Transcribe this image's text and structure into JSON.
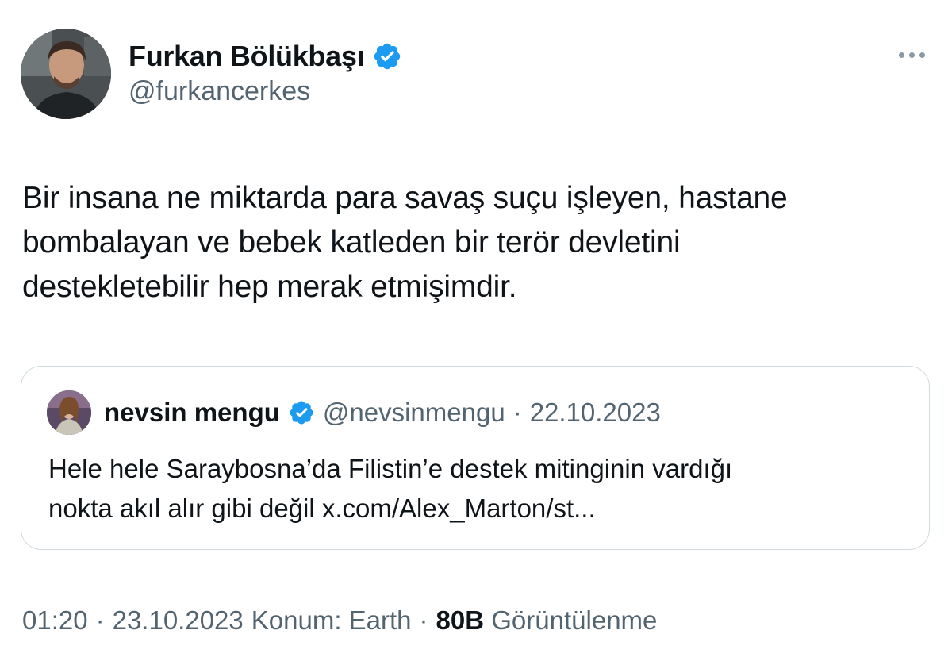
{
  "author": {
    "display_name": "Furkan Bölükbaşı",
    "handle": "@furkancerkes",
    "verified_icon": "verified-badge-icon",
    "verified_color": "#1d9bf0"
  },
  "tweet": {
    "text_lines": [
      "Bir insana ne miktarda para savaş suçu işleyen, hastane",
      "bombalayan ve bebek katleden bir terör devletini",
      "destekletebilir hep merak etmişimdir."
    ]
  },
  "quoted_tweet": {
    "display_name": "nevsin mengu",
    "handle": "@nevsinmengu",
    "separator": "·",
    "date": "22.10.2023",
    "text_lines": [
      "Hele hele Saraybosna’da Filistin’e destek mitinginin vardığı",
      "nokta akıl alır gibi değil x.com/Alex_Marton/st..."
    ]
  },
  "meta": {
    "time": "01:20",
    "sep1": "·",
    "date": "23.10.2023",
    "location": "Konum: Earth",
    "sep2": "·",
    "views_count": "80B",
    "views_label": "Görüntülenme"
  },
  "colors": {
    "text": "#0f1419",
    "secondary": "#536471",
    "border": "#cfd9de",
    "accent": "#1d9bf0"
  }
}
